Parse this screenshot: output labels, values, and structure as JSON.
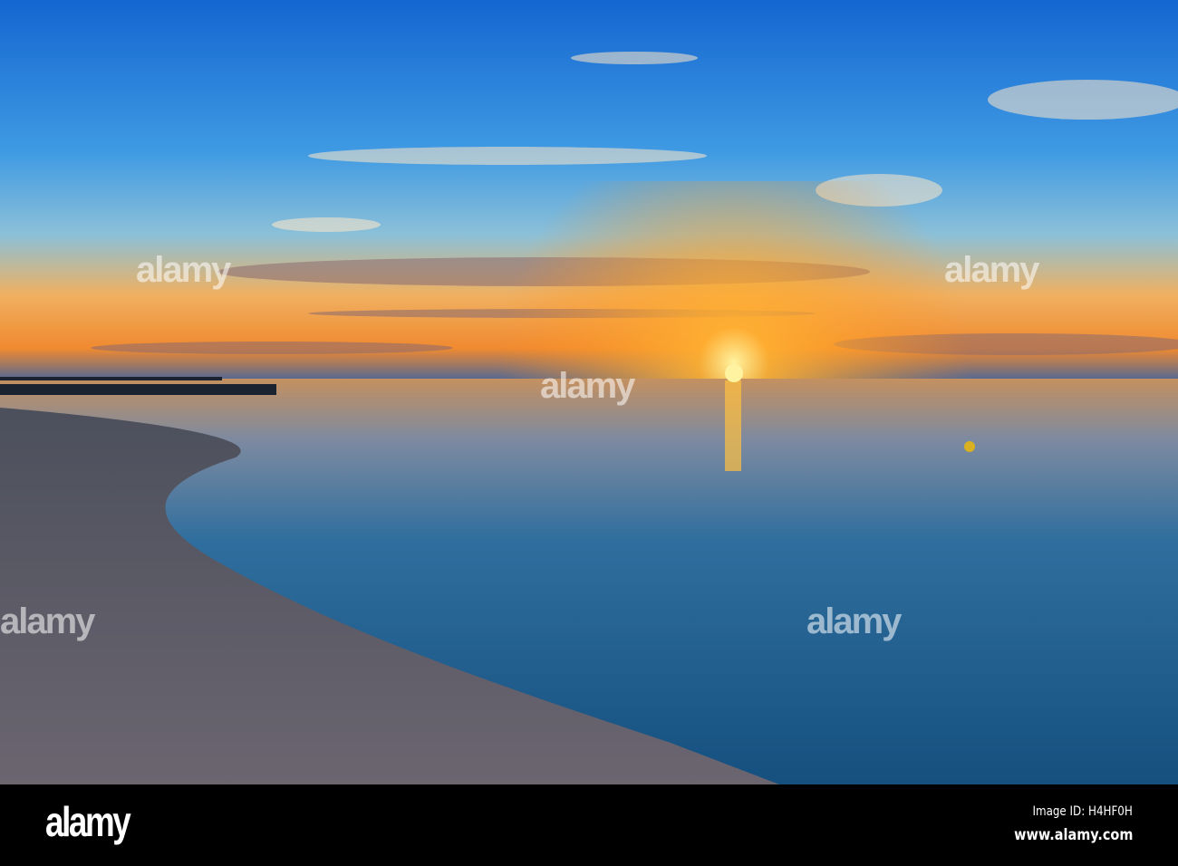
{
  "photo": {
    "subject": "sunset-over-sea-beach",
    "colors": {
      "sky_top": "#1466d0",
      "sky_mid": "#4aa3e6",
      "horizon": "#f5a030",
      "sun": "#ffe070",
      "sea": "#1f5f95",
      "sand": "#555a66"
    }
  },
  "watermark": {
    "text": "alamy"
  },
  "footer": {
    "logo": "alamy",
    "image_id": "Image ID: H4HF0H",
    "website": "www.alamy.com"
  }
}
